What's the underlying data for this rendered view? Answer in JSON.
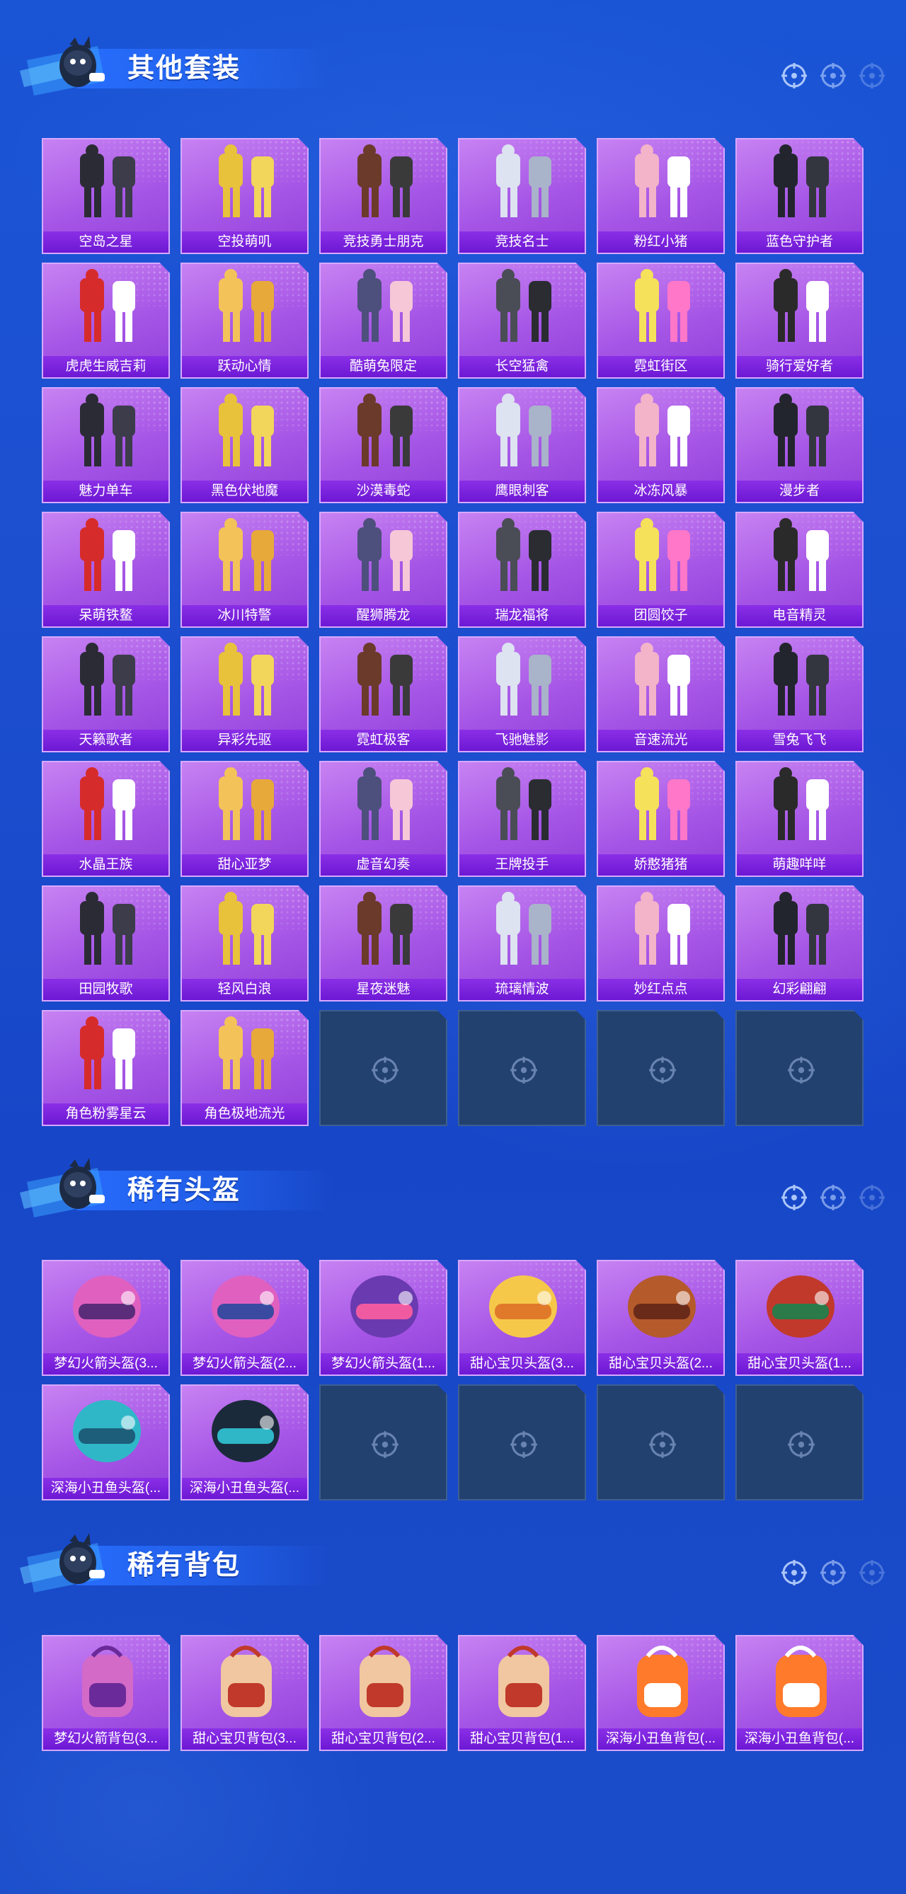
{
  "colors": {
    "item_bg": "#a656e6",
    "label_bg": "#7a22dc",
    "empty_bg": "#23416e",
    "page_bg": "#1a4fd0"
  },
  "sections": [
    {
      "title": "其他套装",
      "items": [
        "空岛之星",
        "空投萌叽",
        "竞技勇士朋克",
        "竞技名士",
        "粉红小猪",
        "蓝色守护者",
        "虎虎生威吉莉",
        "跃动心情",
        "酷萌兔限定",
        "长空猛禽",
        "霓虹街区",
        "骑行爱好者",
        "魅力单车",
        "黑色伏地魔",
        "沙漠毒蛇",
        "鹰眼刺客",
        "冰冻风暴",
        "漫步者",
        "呆萌铁鳌",
        "冰川特警",
        "醒狮腾龙",
        "瑞龙福将",
        "团圆饺子",
        "电音精灵",
        "天籁歌者",
        "异彩先驱",
        "霓虹极客",
        "飞驰魅影",
        "音速流光",
        "雪兔飞飞",
        "水晶王族",
        "甜心亚梦",
        "虚音幻奏",
        "王牌投手",
        "娇憨猪猪",
        "萌趣咩咩",
        "田园牧歌",
        "轻风白浪",
        "星夜迷魅",
        "琉璃情波",
        "妙红点点",
        "幻彩翩翩",
        "角色粉雾星云",
        "角色极地流光"
      ],
      "empty_slots": 4
    },
    {
      "title": "稀有头盔",
      "items": [
        "梦幻火箭头盔(3...",
        "梦幻火箭头盔(2...",
        "梦幻火箭头盔(1...",
        "甜心宝贝头盔(3...",
        "甜心宝贝头盔(2...",
        "甜心宝贝头盔(1...",
        "深海小丑鱼头盔(...",
        "深海小丑鱼头盔(..."
      ],
      "empty_slots": 4
    },
    {
      "title": "稀有背包",
      "items": [
        "梦幻火箭背包(3...",
        "甜心宝贝背包(3...",
        "甜心宝贝背包(2...",
        "甜心宝贝背包(1...",
        "深海小丑鱼背包(...",
        "深海小丑鱼背包(..."
      ],
      "empty_slots": 0
    }
  ],
  "icons": {
    "mascot": "mascot-icon",
    "target": "crosshair-icon",
    "empty": "crosshair-icon"
  }
}
